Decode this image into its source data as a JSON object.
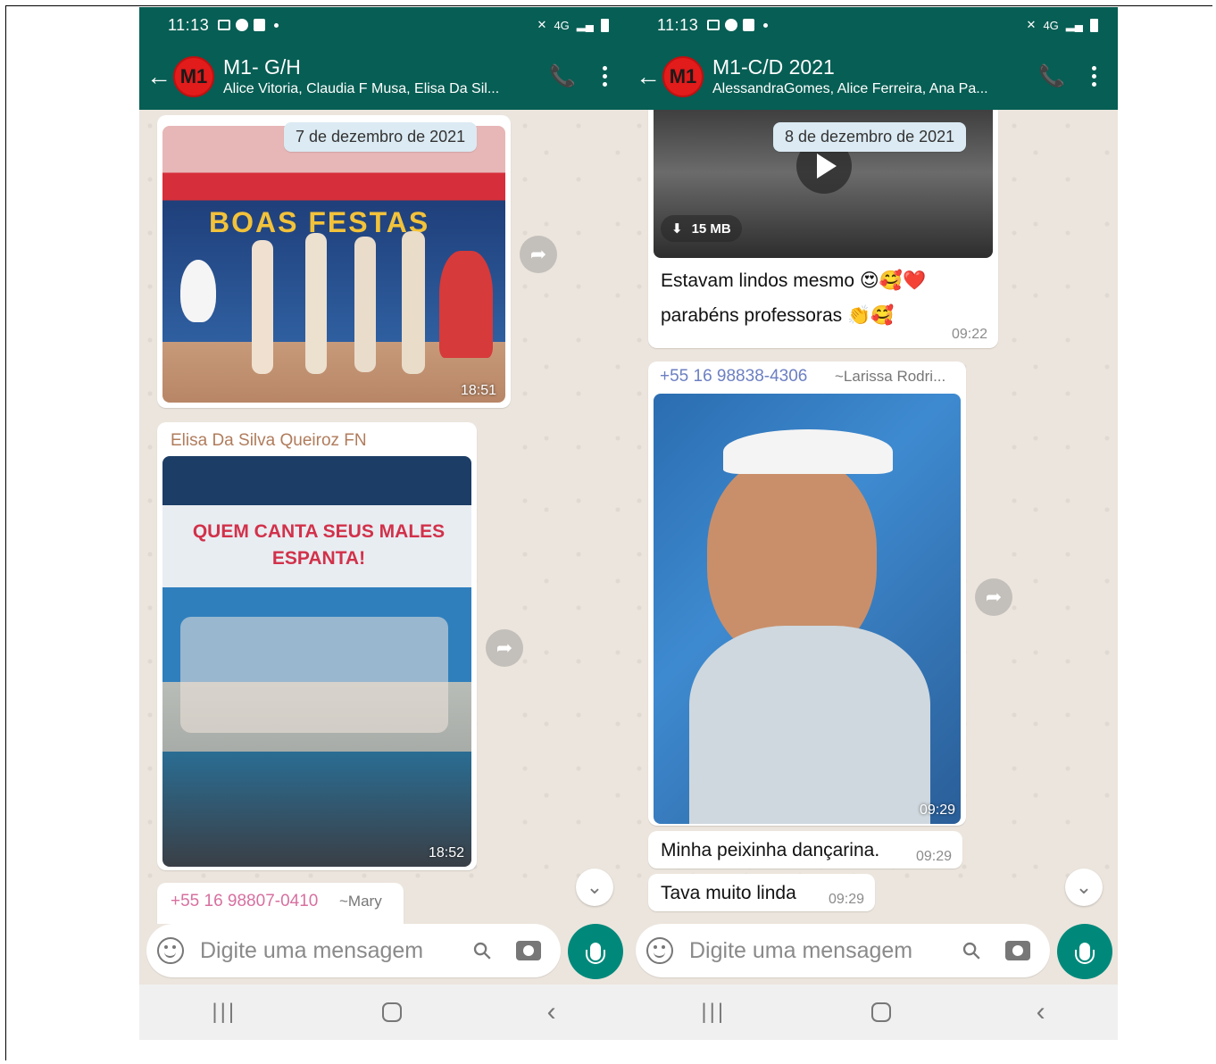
{
  "left_phone": {
    "status": {
      "time": "11:13",
      "network": "4G"
    },
    "header": {
      "avatar_text": "M1",
      "title": "M1- G/H",
      "subtitle": "Alice Vitoria, Claudia F Musa, Elisa Da Sil..."
    },
    "date_chip": "7 de dezembro de 2021",
    "messages": [
      {
        "image_text": "BOAS FESTAS",
        "time": "18:51"
      },
      {
        "sender": "Elisa Da Silva Queiroz FN",
        "image_text": "QUEM CANTA SEUS MALES ESPANTA!",
        "time": "18:52"
      },
      {
        "sender_phone": "+55 16 98807-0410",
        "sender_alias": "~Mary"
      }
    ],
    "input_placeholder": "Digite uma mensagem"
  },
  "right_phone": {
    "status": {
      "time": "11:13",
      "network": "4G"
    },
    "header": {
      "avatar_text": "M1",
      "title": "M1-C/D 2021",
      "subtitle": "AlessandraGomes, Alice Ferreira, Ana Pa..."
    },
    "date_chip": "8 de dezembro de 2021",
    "messages": [
      {
        "video_size": "15 MB",
        "text_line1": "Estavam lindos mesmo 😍🥰❤️",
        "text_line2": "parabéns professoras 👏🥰",
        "time": "09:22"
      },
      {
        "sender_phone": "+55 16 98838-4306",
        "sender_alias": "~Larissa Rodri...",
        "time": "09:29"
      },
      {
        "text": "Minha peixinha dançarina.",
        "time": "09:29"
      },
      {
        "text": "Tava muito linda",
        "time": "09:29"
      }
    ],
    "input_placeholder": "Digite uma mensagem"
  },
  "colors": {
    "header": "#075e54",
    "accent": "#00897b",
    "chat_bg": "#ece5dd",
    "date_chip": "#dbeaf3"
  },
  "icons": [
    "back-arrow-icon",
    "add-call-icon",
    "more-vert-icon",
    "forward-icon",
    "scroll-down-icon",
    "emoji-icon",
    "attach-icon",
    "camera-icon",
    "mic-icon",
    "play-icon",
    "download-icon"
  ]
}
